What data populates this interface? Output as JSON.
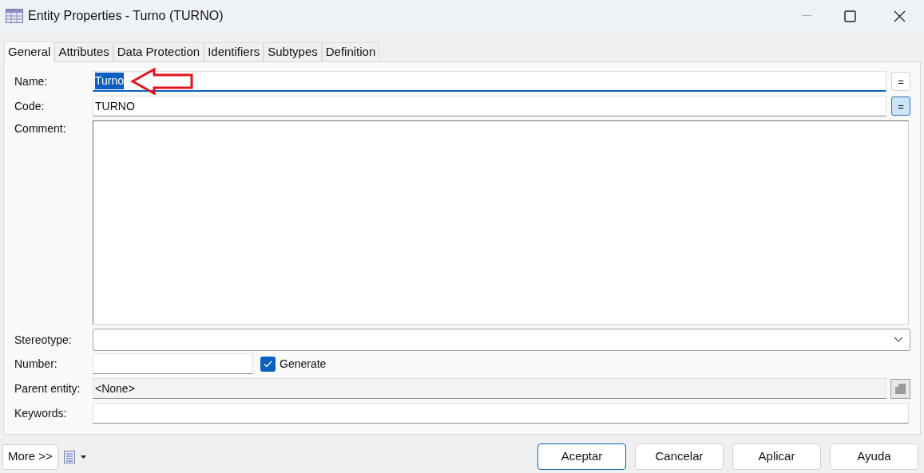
{
  "window": {
    "title": "Entity Properties - Turno (TURNO)"
  },
  "tabs": [
    {
      "label": "General",
      "selected": true
    },
    {
      "label": "Attributes",
      "selected": false
    },
    {
      "label": "Data Protection",
      "selected": false
    },
    {
      "label": "Identifiers",
      "selected": false
    },
    {
      "label": "Subtypes",
      "selected": false
    },
    {
      "label": "Definition",
      "selected": false
    }
  ],
  "fields": [
    {
      "kind": "text",
      "label": "Name:",
      "value": "Turno",
      "focused": true,
      "text_selected": true,
      "sync_button": {
        "label": "=",
        "pressed": false
      }
    },
    {
      "kind": "text",
      "label": "Code:",
      "value": "TURNO",
      "focused": false,
      "text_selected": false,
      "sync_button": {
        "label": "=",
        "pressed": true
      }
    },
    {
      "kind": "memo",
      "label": "Comment:"
    },
    {
      "kind": "select",
      "label": "Stereotype:"
    },
    {
      "kind": "number",
      "label": "Number:",
      "checkbox": {
        "label": "Generate",
        "checked": true
      }
    },
    {
      "kind": "readonly",
      "label": "Parent entity:",
      "value": "<None>"
    },
    {
      "kind": "plain",
      "label": "Keywords:"
    }
  ],
  "footer": {
    "more_button": "More >>",
    "buttons": [
      {
        "label": "Aceptar",
        "default": true
      },
      {
        "label": "Cancelar",
        "default": false
      },
      {
        "label": "Aplicar",
        "default": false
      },
      {
        "label": "Ayuda",
        "default": false
      }
    ]
  }
}
